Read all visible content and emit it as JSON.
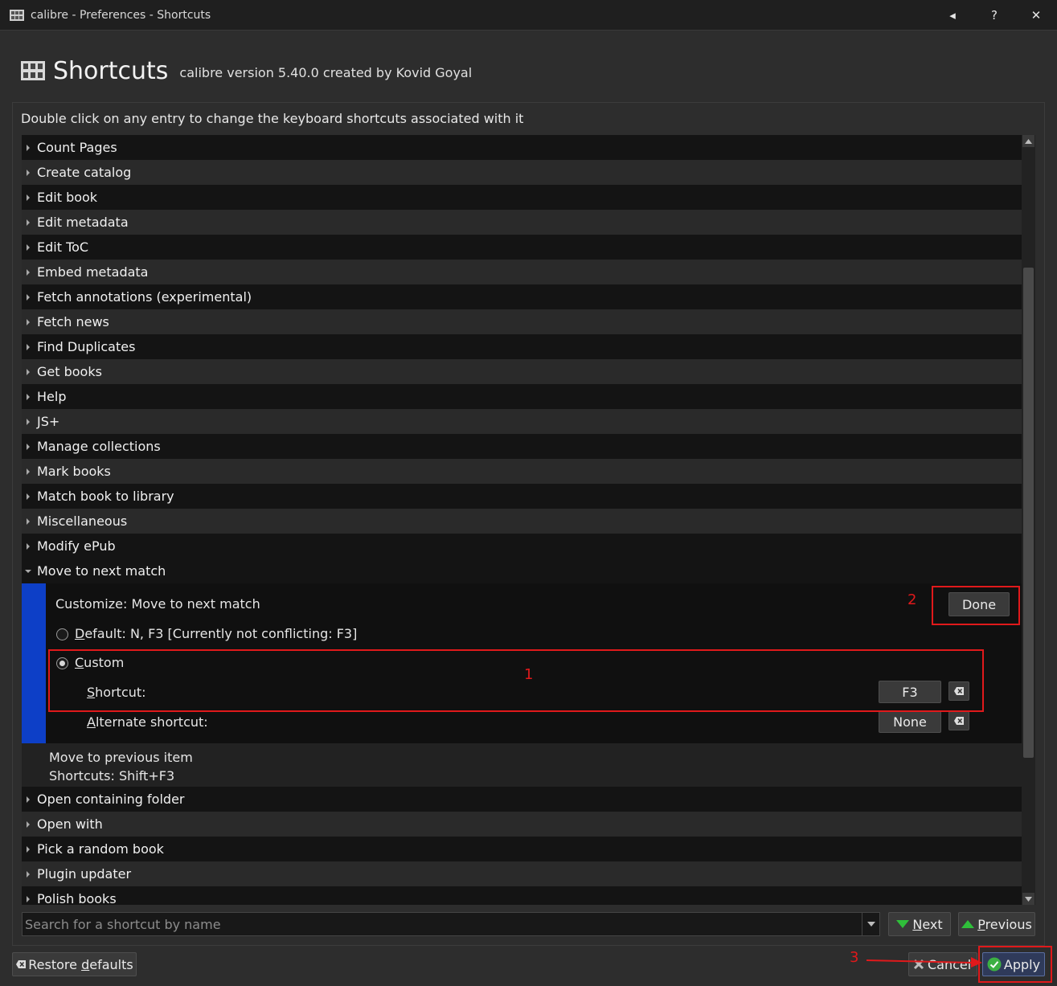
{
  "window": {
    "title": "calibre - Preferences - Shortcuts",
    "controls": {
      "back": "◂",
      "help": "?",
      "close": "✕"
    }
  },
  "header": {
    "title": "Shortcuts",
    "version": "calibre version 5.40.0 created by Kovid Goyal"
  },
  "instructions": "Double click on any entry to change the keyboard shortcuts associated with it",
  "list": {
    "items_before": [
      "Count Pages",
      "Create catalog",
      "Edit book",
      "Edit metadata",
      "Edit ToC",
      "Embed metadata",
      "Fetch annotations (experimental)",
      "Fetch news",
      "Find Duplicates",
      "Get books",
      "Help",
      "JS+",
      "Manage collections",
      "Mark books",
      "Match book to library",
      "Miscellaneous",
      "Modify ePub"
    ],
    "expanded_group": "Move to next match",
    "items_after": [
      "Open containing folder",
      "Open with",
      "Pick a random book",
      "Plugin updater",
      "Polish books"
    ]
  },
  "editor": {
    "title": "Customize: Move to next match",
    "done": "Done",
    "default_ul": "D",
    "default_rest": "efault: N, F3 [Currently not conflicting: F3]",
    "custom_ul": "C",
    "custom_rest": "ustom",
    "shortcut_ul": "S",
    "shortcut_rest": "hortcut:",
    "shortcut_value": "F3",
    "alt_ul": "A",
    "alt_rest": "lternate shortcut:",
    "alt_value": "None"
  },
  "plain_item": {
    "name": "Move to previous item",
    "shortcuts": "Shortcuts: Shift+F3"
  },
  "search": {
    "placeholder": "Search for a shortcut by name"
  },
  "nav": {
    "next_ul": "N",
    "next_rest": "ext",
    "prev_ul": "P",
    "prev_rest": "revious"
  },
  "footer": {
    "restore_pre": "Restore ",
    "restore_ul": "d",
    "restore_post": "efaults",
    "cancel": "Cancel",
    "apply": "Apply"
  },
  "annotations": [
    "1",
    "2",
    "3"
  ],
  "colors": {
    "annotation": "#e0191b",
    "selection_bar": "#0d3fc7",
    "next_arrow": "#2fbf3a",
    "apply_check": "#3cb043"
  }
}
